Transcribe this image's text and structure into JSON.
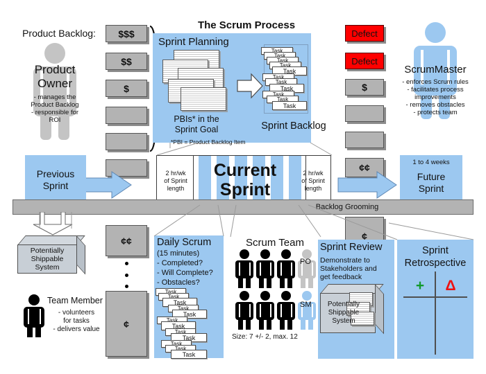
{
  "diagram": {
    "title": "The Scrum Process",
    "footnote": "*PBI = Product Backlog Item"
  },
  "product_owner": {
    "backlog_label": "Product Backlog:",
    "role": "Product\nOwner",
    "role_line1": "Product",
    "role_line2": "Owner",
    "bullets": "- manages the\nProduct Backlog\n- responsible for\nROI",
    "figure_color": "#c4c4c4"
  },
  "scrum_master": {
    "role": "ScrumMaster",
    "bullets": "- enforces Scrum rules\n- facilitates process\nimprovements\n- removes obstacles\n- protects team",
    "figure_color": "#9cc8f0"
  },
  "backlog_items": [
    {
      "label": "$$$",
      "type": "gray"
    },
    {
      "label": "$$",
      "type": "gray"
    },
    {
      "label": "$",
      "type": "gray"
    },
    {
      "label": "",
      "type": "gray"
    },
    {
      "label": "",
      "type": "gray"
    },
    {
      "label": "",
      "type": "gray"
    },
    {
      "label": "¢¢",
      "type": "gray"
    },
    {
      "label": "¢",
      "type": "gray"
    }
  ],
  "right_backlog_items": [
    {
      "label": "Defect",
      "type": "red"
    },
    {
      "label": "Defect",
      "type": "red"
    },
    {
      "label": "$",
      "type": "gray"
    },
    {
      "label": "",
      "type": "gray"
    },
    {
      "label": "",
      "type": "gray"
    },
    {
      "label": "¢¢",
      "type": "gray"
    },
    {
      "label": "¢",
      "type": "gray"
    }
  ],
  "sprint_planning": {
    "heading": "Sprint Planning",
    "caption_line1": "PBIs* in the",
    "caption_line2": "Sprint Goal",
    "backlog_heading": "Sprint Backlog",
    "task_label": "Task"
  },
  "timeline": {
    "previous_sprint": "Previous\nSprint",
    "previous_sprint_line1": "Previous",
    "previous_sprint_line2": "Sprint",
    "current_sprint_line1": "Current",
    "current_sprint_line2": "Sprint",
    "future_sprint_duration": "1 to 4 weeks",
    "future_sprint_line1": "Future",
    "future_sprint_line2": "Sprint",
    "grooming_label": "Backlog Grooming",
    "planning_note_left": "2 hr/wk\nof Sprint\nlength",
    "planning_note_right": "2 hr/wk\nof Sprint\nlength",
    "note_l1": "2 hr/wk",
    "note_l2": "of Sprint",
    "note_l3": "length"
  },
  "shippable": {
    "line1": "Potentially",
    "line2": "Shippable",
    "line3": "System"
  },
  "team_member": {
    "title": "Team Member",
    "bullets": "- volunteers\nfor tasks\n- delivers value",
    "b1": "- volunteers",
    "b2": "for tasks",
    "b3": "- delivers value"
  },
  "daily_scrum": {
    "heading": "Daily Scrum",
    "duration": "(15 minutes)",
    "q1": "- Completed?",
    "q2": "- Will Complete?",
    "q3": "- Obstacles?",
    "task_label": "Task"
  },
  "scrum_team": {
    "heading": "Scrum Team",
    "po_label": "PO",
    "sm_label": "SM",
    "size_note": "Size: 7 +/- 2, max. 12"
  },
  "sprint_review": {
    "heading": "Sprint Review",
    "body_l1": "Demonstrate to",
    "body_l2": "Stakeholders and",
    "body_l3": "get feedback",
    "box_l1": "Potentially",
    "box_l2": "Shippable",
    "box_l3": "System"
  },
  "sprint_retrospective": {
    "heading_l1": "Sprint",
    "heading_l2": "Retrospective",
    "plus_symbol": "+",
    "delta_symbol": "Δ"
  },
  "colors": {
    "accent_blue": "#9cc8f0",
    "gray": "#b3b3b3",
    "defect_red": "#ff0000",
    "plus_green": "#11992b",
    "delta_red": "#ee1111"
  }
}
